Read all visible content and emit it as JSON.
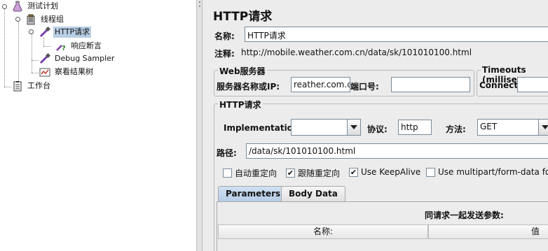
{
  "tree": {
    "items": [
      {
        "label": "测试计划",
        "icon": "test-plan-flask-icon"
      },
      {
        "label": "线程组",
        "icon": "thread-group-icon"
      },
      {
        "label": "HTTP请求",
        "icon": "sampler-pipette-icon",
        "selected": true
      },
      {
        "label": "响应断言",
        "icon": "assertion-icon"
      },
      {
        "label": "Debug Sampler",
        "icon": "sampler-pipette-icon"
      },
      {
        "label": "察看结果树",
        "icon": "listener-results-icon"
      },
      {
        "label": "工作台",
        "icon": "workbench-clipboard-icon"
      }
    ]
  },
  "panel": {
    "title": "HTTP请求",
    "name_label": "名称:",
    "name_value": "HTTP请求",
    "comment_label": "注释:",
    "comment_value": "http://mobile.weather.com.cn/data/sk/101010100.html",
    "web_server": {
      "legend": "Web服务器",
      "server_label": "服务器名称或IP:",
      "server_value": "reather.com.cn",
      "port_label": "端口号:",
      "port_value": ""
    },
    "timeouts": {
      "legend": "Timeouts (millise",
      "connect_label": "Connect:",
      "connect_value": ""
    },
    "http_request": {
      "legend": "HTTP请求",
      "impl_label": "Implementation:",
      "impl_value": "",
      "protocol_label": "协议:",
      "protocol_value": "http",
      "method_label": "方法:",
      "method_value": "GET",
      "path_label": "路径:",
      "path_value": "/data/sk/101010100.html"
    },
    "options": [
      {
        "label": "自动重定向",
        "checked": false
      },
      {
        "label": "跟随重定向",
        "checked": true
      },
      {
        "label": "Use KeepAlive",
        "checked": true
      },
      {
        "label": "Use multipart/form-data for P",
        "checked": false
      }
    ],
    "tabs": [
      {
        "label": "Parameters",
        "active": true
      },
      {
        "label": "Body Data",
        "active": false
      }
    ],
    "params_caption": "同请求一起发送参数:",
    "table_headers": [
      "名称:",
      "值"
    ]
  }
}
